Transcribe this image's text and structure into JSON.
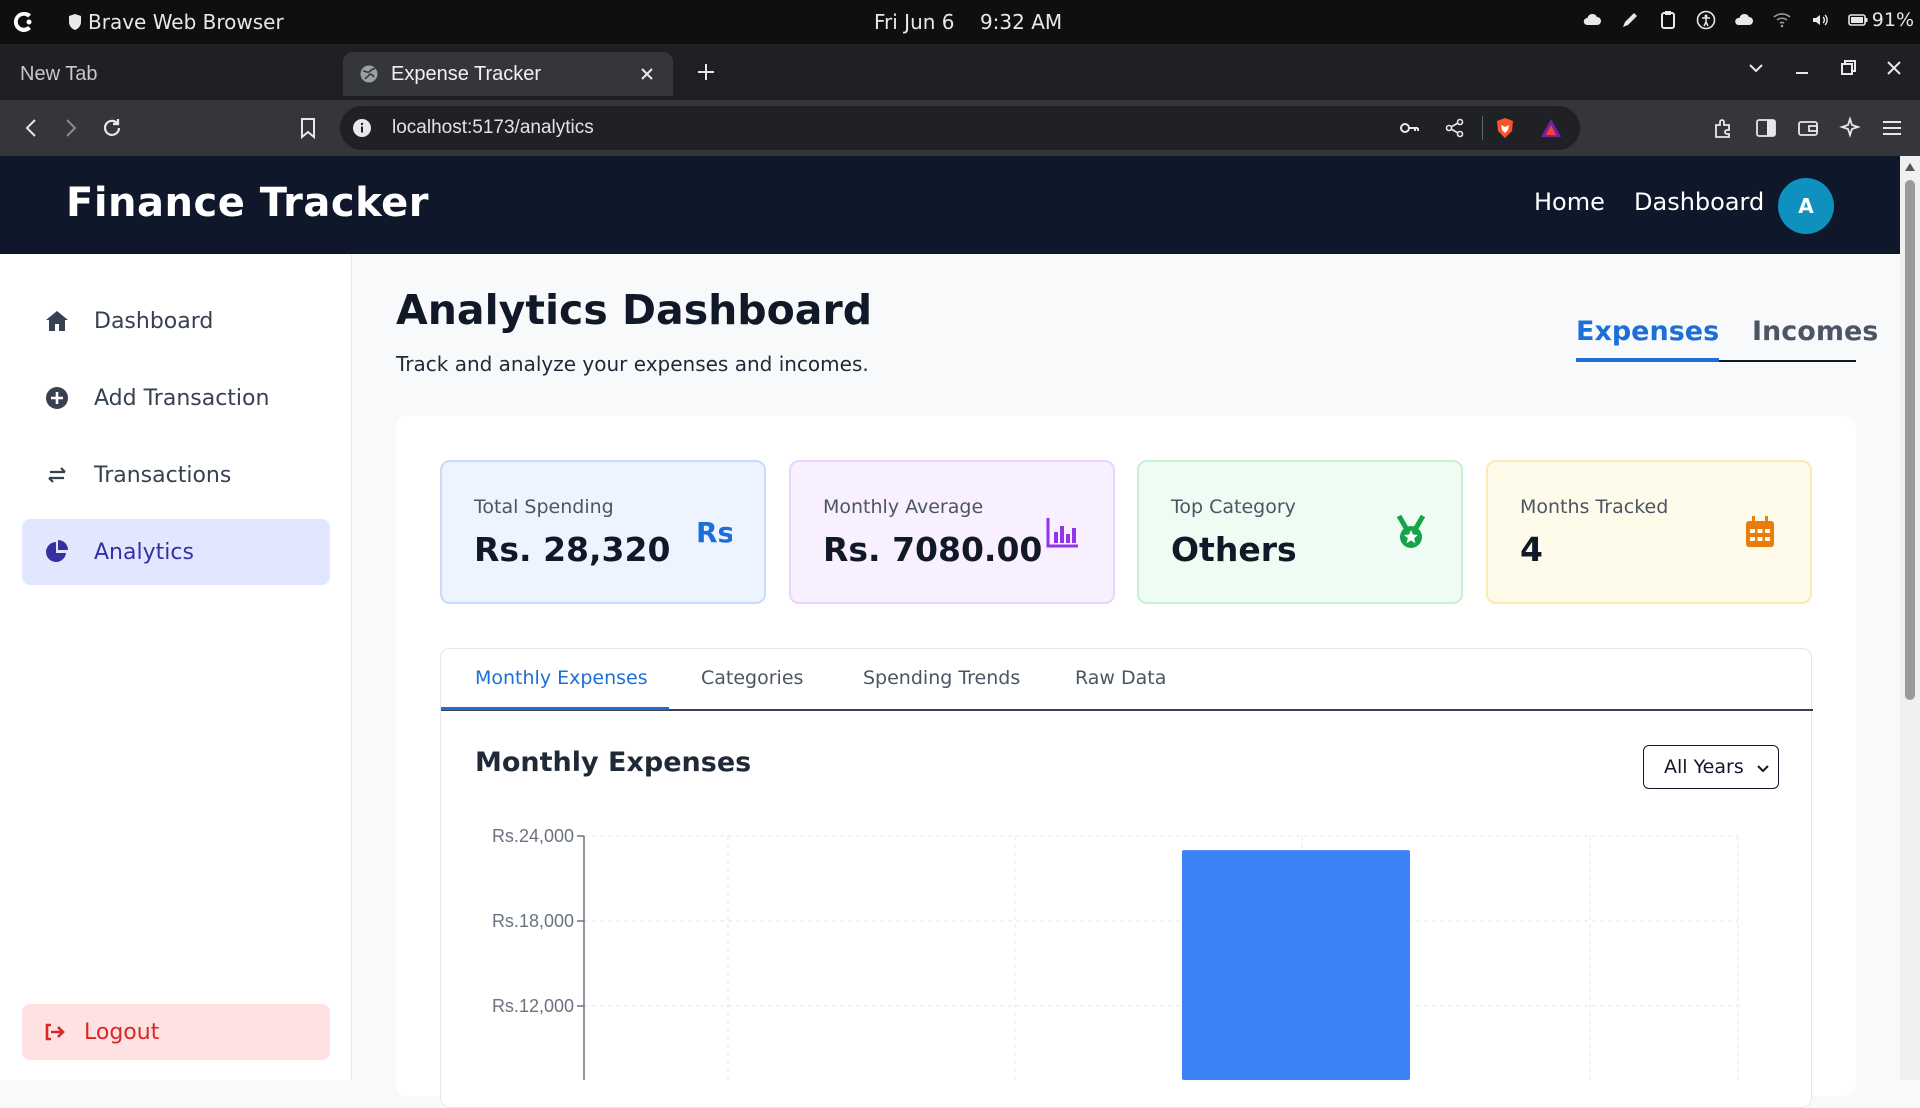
{
  "os": {
    "app_name": "Brave Web Browser",
    "clock": "Fri Jun 6    9:32 AM",
    "battery": "91%"
  },
  "browser": {
    "tabs": [
      {
        "label": "New Tab"
      },
      {
        "label": "Expense Tracker"
      }
    ],
    "url": "localhost:5173/analytics"
  },
  "header": {
    "brand": "Finance Tracker",
    "links": [
      "Home",
      "Dashboard"
    ],
    "avatar_letter": "A"
  },
  "sidebar": {
    "items": [
      {
        "label": "Dashboard",
        "icon": "home-icon"
      },
      {
        "label": "Add Transaction",
        "icon": "plus-circle-icon"
      },
      {
        "label": "Transactions",
        "icon": "swap-arrows-icon"
      },
      {
        "label": "Analytics",
        "icon": "pie-chart-icon",
        "active": true
      }
    ],
    "logout_label": "Logout"
  },
  "main": {
    "title": "Analytics Dashboard",
    "subtitle": "Track and analyze your expenses and incomes.",
    "type_tabs": [
      "Expenses",
      "Incomes"
    ],
    "stats": [
      {
        "label": "Total Spending",
        "value": "Rs. 28,320",
        "icon": "rupee-icon",
        "color": "#1d6fd8"
      },
      {
        "label": "Monthly Average",
        "value": "Rs. 7080.00",
        "icon": "bar-chart-icon",
        "color": "#9333ea"
      },
      {
        "label": "Top Category",
        "value": "Others",
        "icon": "medal-icon",
        "color": "#16a34a"
      },
      {
        "label": "Months Tracked",
        "value": "4",
        "icon": "calendar-icon",
        "color": "#ea7c0c"
      }
    ],
    "chart_tabs": [
      "Monthly Expenses",
      "Categories",
      "Spending Trends",
      "Raw Data"
    ],
    "chart_title": "Monthly Expenses",
    "year_filter": "All Years"
  },
  "colors": {
    "accent": "#1d6fd8",
    "header_bg": "#0f172a",
    "bar": "#3b82f6"
  },
  "chart_data": {
    "type": "bar",
    "title": "Monthly Expenses",
    "ylim": [
      6000,
      24000
    ],
    "yticks": [
      24000,
      18000,
      12000
    ],
    "ytick_labels": [
      "Rs.24,000",
      "Rs.18,000",
      "Rs.12,000"
    ],
    "bar_value": 23000,
    "grid": true
  }
}
